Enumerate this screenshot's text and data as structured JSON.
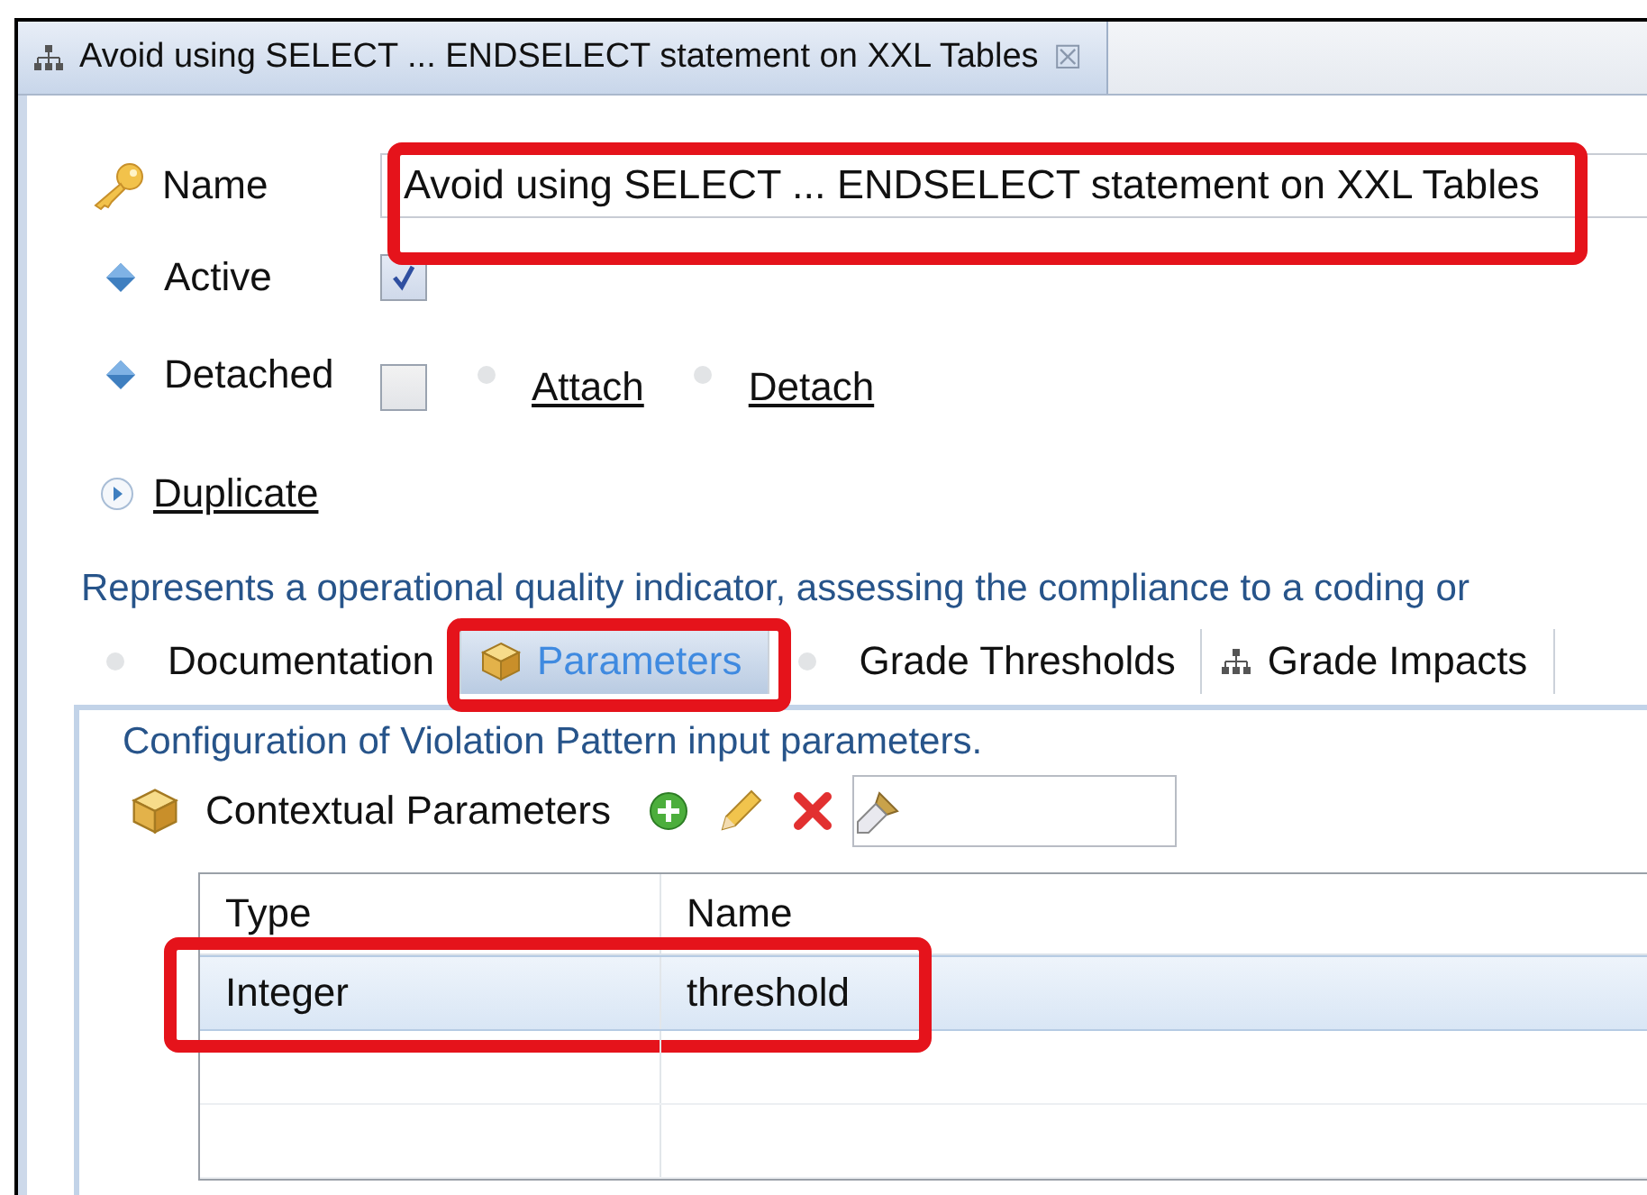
{
  "editor_tab": {
    "title": "Avoid using SELECT ... ENDSELECT statement on XXL Tables",
    "close": "☒"
  },
  "form": {
    "name_label": "Name",
    "name_value": "Avoid using SELECT ... ENDSELECT statement on XXL Tables",
    "name_highlighted": true,
    "active_label": "Active",
    "active_checked": true,
    "detached_label": "Detached",
    "detached_checked": false,
    "links": [
      "Attach",
      "Detach"
    ],
    "duplicate": "Duplicate",
    "description": "Represents a operational quality indicator, assessing the compliance to a coding or"
  },
  "tabs": [
    {
      "label": "Documentation",
      "kind": "dot",
      "selected": false,
      "highlighted": false
    },
    {
      "label": "Parameters",
      "kind": "cube",
      "selected": true,
      "highlighted": true
    },
    {
      "label": "Grade Thresholds",
      "kind": "dot",
      "selected": false,
      "highlighted": false
    },
    {
      "label": "Grade Impacts",
      "kind": "tree",
      "selected": false,
      "highlighted": false
    }
  ],
  "panel": {
    "caption": "Configuration of Violation Pattern input parameters.",
    "section": "Contextual Parameters",
    "table": {
      "columns": [
        "Type",
        "Name"
      ],
      "rows": [
        {
          "cells": [
            "Integer",
            "threshold"
          ],
          "selected": true,
          "highlighted": true
        }
      ]
    }
  }
}
